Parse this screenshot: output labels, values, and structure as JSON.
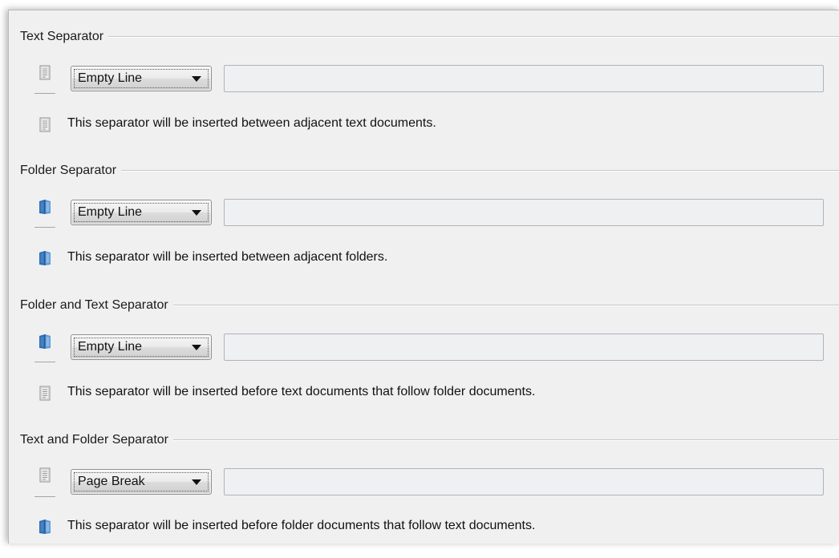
{
  "sections": [
    {
      "title": "Text Separator",
      "selector_icon": "text-document-icon",
      "dropdown_value": "Empty Line",
      "custom_text": "",
      "description_icon": "text-document-icon",
      "description": "This separator will be inserted between adjacent text documents."
    },
    {
      "title": "Folder Separator",
      "selector_icon": "folder-icon",
      "dropdown_value": "Empty Line",
      "custom_text": "",
      "description_icon": "folder-icon",
      "description": "This separator will be inserted between adjacent folders."
    },
    {
      "title": "Folder and Text Separator",
      "selector_icon": "folder-icon",
      "dropdown_value": "Empty Line",
      "custom_text": "",
      "description_icon": "text-document-icon",
      "description": "This separator will be inserted before text documents that follow folder documents."
    },
    {
      "title": "Text and Folder Separator",
      "selector_icon": "text-document-icon",
      "dropdown_value": "Page Break",
      "custom_text": "",
      "description_icon": "folder-icon",
      "description": "This separator will be inserted before folder documents that follow text documents."
    }
  ],
  "colors": {
    "panel_background": "#f0f0f0",
    "folder_blue": "#3f7fbf",
    "document_gray": "#8c8c8c"
  }
}
